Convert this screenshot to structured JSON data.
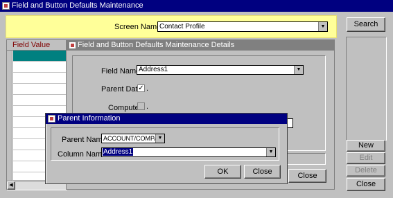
{
  "window": {
    "title": "Field and Button Defaults Maintenance"
  },
  "screen": {
    "label": "Screen Name",
    "value": "Contact Profile"
  },
  "buttons": {
    "search": "Search",
    "new": "New",
    "edit": "Edit",
    "delete": "Delete",
    "close": "Close"
  },
  "grid": {
    "header": "Field Value"
  },
  "details": {
    "title": "Field and Button Defaults Maintenance Details",
    "field_name_label": "Field Name",
    "field_name_value": "Address1",
    "parent_data_label": "Parent Data",
    "parent_data_checked": true,
    "compute_label": "Compute",
    "compute_checked": false,
    "close_label": "Close"
  },
  "parent_dialog": {
    "title": "Parent Information",
    "parent_name_label": "Parent Name",
    "parent_name_value": "ACCOUNT/COMPA...",
    "column_name_label": "Column Name",
    "column_name_value": "Address1",
    "ok_label": "OK",
    "close_label": "Close"
  },
  "icons": {
    "app": "app-icon",
    "dropdown": "chevron-down-icon",
    "lookup": "lookup-icon",
    "check": "check-icon"
  },
  "colors": {
    "titlebar": "#000080",
    "highlight": "#ffff99",
    "selected_row": "#008080",
    "header_text": "#800000"
  }
}
